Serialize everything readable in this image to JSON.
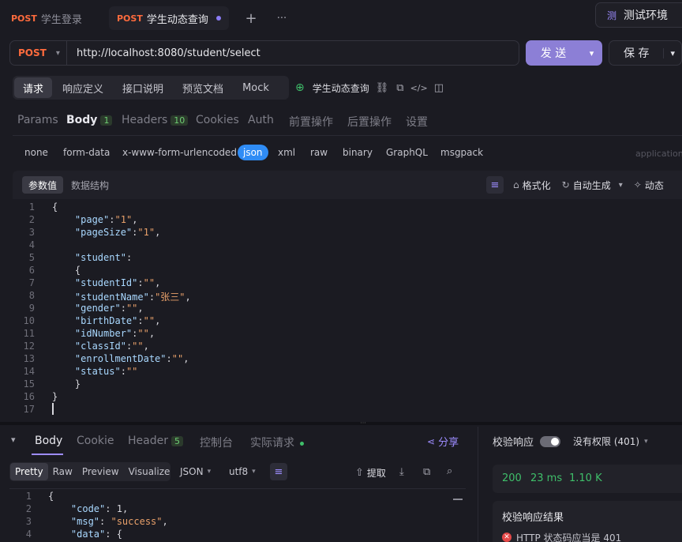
{
  "tabs": [
    {
      "method": "POST",
      "name": "学生登录"
    },
    {
      "method": "POST",
      "name": "学生动态查询"
    }
  ],
  "env": {
    "badge": "测",
    "label": "测试环境"
  },
  "request": {
    "method": "POST",
    "url": "http://localhost:8080/student/select",
    "send_label": "发 送",
    "save_label": "保 存"
  },
  "sub_tabs": [
    "请求",
    "响应定义",
    "接口说明",
    "预览文档",
    "Mock"
  ],
  "api_name": "学生动态查询",
  "param_tabs": [
    {
      "label": "Params"
    },
    {
      "label": "Body",
      "count": "1"
    },
    {
      "label": "Headers",
      "count": "10"
    },
    {
      "label": "Cookies"
    },
    {
      "label": "Auth"
    },
    {
      "label": "前置操作"
    },
    {
      "label": "后置操作"
    },
    {
      "label": "设置"
    }
  ],
  "body_types": [
    "none",
    "form-data",
    "x-www-form-urlencoded",
    "json",
    "xml",
    "raw",
    "binary",
    "GraphQL",
    "msgpack"
  ],
  "content_type_hint": "application",
  "editor": {
    "tabs": [
      "参数值",
      "数据结构"
    ],
    "actions": {
      "format": "格式化",
      "auto": "自动生成",
      "dynamic": "动态"
    },
    "lines": [
      "{",
      "    \"page\":\"1\",",
      "    \"pageSize\":\"1\",",
      "",
      "    \"student\":",
      "    {",
      "    \"studentId\":\"\",",
      "    \"studentName\":\"张三\",",
      "    \"gender\":\"\",",
      "    \"birthDate\":\"\",",
      "    \"idNumber\":\"\",",
      "    \"classId\":\"\",",
      "    \"enrollmentDate\":\"\",",
      "    \"status\":\"\"",
      "    }",
      "}",
      ""
    ]
  },
  "response": {
    "tabs": [
      {
        "label": "Body"
      },
      {
        "label": "Cookie"
      },
      {
        "label": "Header",
        "count": "5"
      },
      {
        "label": "控制台"
      },
      {
        "label": "实际请求"
      }
    ],
    "share": "分享",
    "formats": [
      "Pretty",
      "Raw",
      "Preview",
      "Visualize"
    ],
    "lang": "JSON",
    "encoding": "utf8",
    "extract": "提取",
    "lines": [
      "{",
      "    \"code\": 1,",
      "    \"msg\": \"success\",",
      "    \"data\": {"
    ]
  },
  "validation": {
    "label": "校验响应",
    "permission": "没有权限 (401)",
    "status": "200",
    "time": "23 ms",
    "size": "1.10 K",
    "result_title": "校验响应结果",
    "result_item": "HTTP 状态码应当是 401"
  }
}
